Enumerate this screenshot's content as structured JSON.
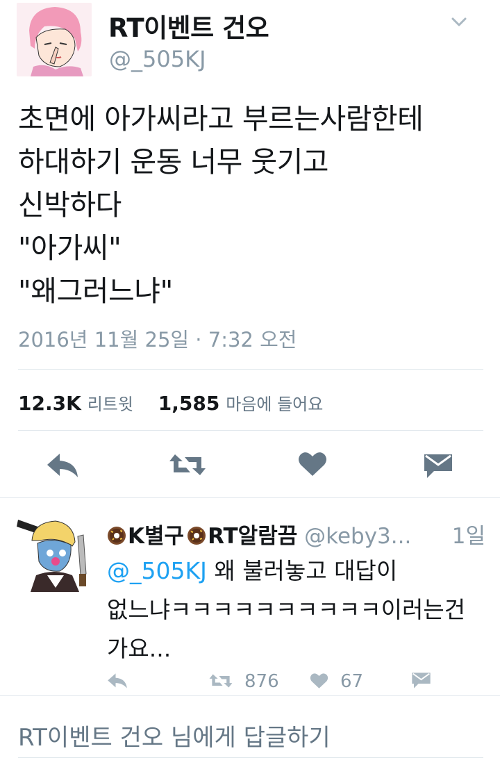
{
  "tweet": {
    "display_name": "RT이벤트 건오",
    "handle": "@_505KJ",
    "text_lines": [
      "초면에 아가씨라고 부르는사람한테",
      "하대하기 운동 너무 웃기고",
      "신박하다",
      "\"아가씨\"",
      "\"왜그러느냐\""
    ],
    "timestamp": "2016년 11월 25일 · 7:32 오전",
    "retweet_count": "12.3K",
    "retweet_label": "리트윗",
    "like_count": "1,585",
    "like_label": "마음에 들어요"
  },
  "reply": {
    "name_part1": "K별구",
    "name_part2": "RT알람끔",
    "handle": "@keby3...",
    "time": "1일",
    "mention": "@_505KJ",
    "text_line1_rest": " 왜 불러놓고 대답이",
    "text_line2": "없느냐ㅋㅋㅋㅋㅋㅋㅋㅋㅋㅋ이러는건",
    "text_line3": "가요...",
    "retweet_count": "876",
    "like_count": "67"
  },
  "compose": {
    "placeholder": "RT이벤트 건오 님에게 답글하기"
  },
  "icons": {
    "reply": "reply-icon",
    "retweet": "retweet-icon",
    "like": "heart-icon",
    "dm": "envelope-icon",
    "more": "chevron-down-icon",
    "donut": "donut-emoji-icon"
  },
  "colors": {
    "text": "#14171a",
    "secondary": "#8899a6",
    "link": "#1da1f2",
    "icon": "#657786"
  }
}
